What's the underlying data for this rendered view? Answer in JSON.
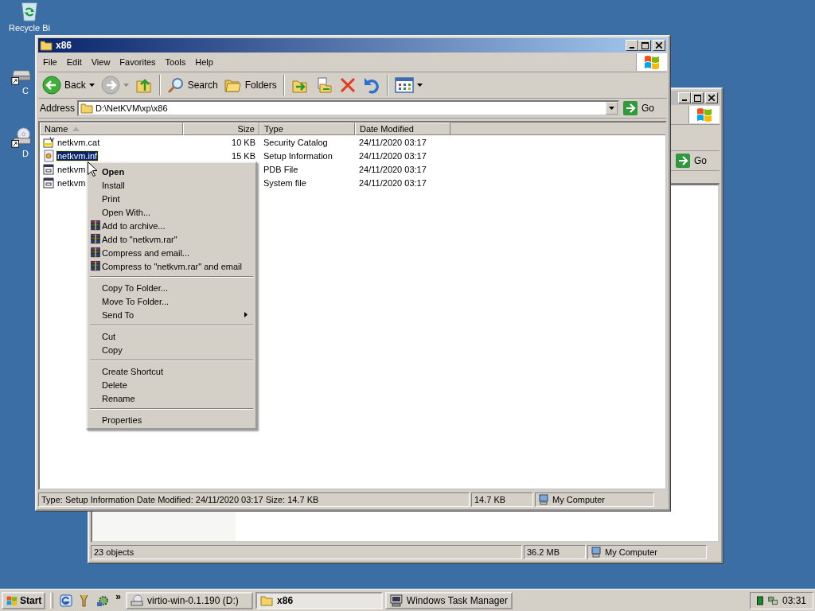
{
  "desktop_icons": [
    {
      "kind": "recycle",
      "label": "Recycle Bi"
    },
    {
      "kind": "drive",
      "label": "C"
    },
    {
      "kind": "cd",
      "label": "D"
    }
  ],
  "back_window": {
    "go": "Go",
    "status_bar": [
      "23 objects",
      "36.2 MB",
      "My Computer"
    ]
  },
  "window": {
    "title": "x86",
    "menu": [
      "File",
      "Edit",
      "View",
      "Favorites",
      "Tools",
      "Help"
    ],
    "toolbar": [
      {
        "kind": "back",
        "label": "Back"
      },
      {
        "kind": "forward"
      },
      {
        "kind": "up"
      },
      {
        "kind": "sep"
      },
      {
        "kind": "search",
        "label": "Search"
      },
      {
        "kind": "folders",
        "label": "Folders"
      },
      {
        "kind": "sep"
      },
      {
        "kind": "moveto"
      },
      {
        "kind": "copyto"
      },
      {
        "kind": "delete"
      },
      {
        "kind": "undo"
      },
      {
        "kind": "sep"
      },
      {
        "kind": "views"
      }
    ],
    "address": {
      "label": "Address",
      "value": "D:\\NetKVM\\xp\\x86",
      "go": "Go"
    },
    "columns": [
      {
        "label": "Name",
        "sorted": true
      },
      {
        "label": "Size",
        "sorted": false
      },
      {
        "label": "Type",
        "sorted": false
      },
      {
        "label": "Date Modified",
        "sorted": false
      }
    ],
    "rows": [
      {
        "kind": "catalog",
        "name": "netkvm.cat",
        "size": "10 KB",
        "type": "Security Catalog",
        "date": "24/11/2020 03:17",
        "selected": false
      },
      {
        "kind": "setup",
        "name": "netkvm.inf",
        "size": "15 KB",
        "type": "Setup Information",
        "date": "24/11/2020 03:17",
        "selected": true
      },
      {
        "kind": "file",
        "name": "netkvm",
        "size": "",
        "type": "PDB File",
        "date": "24/11/2020 03:17",
        "selected": false
      },
      {
        "kind": "file",
        "name": "netkvm",
        "size": "",
        "type": "System file",
        "date": "24/11/2020 03:17",
        "selected": false
      }
    ],
    "status_bar": [
      "Type: Setup Information Date Modified: 24/11/2020 03:17 Size: 14.7 KB",
      "14.7 KB",
      "My Computer"
    ]
  },
  "context_menu": [
    {
      "kind": "default",
      "label": "Open"
    },
    {
      "kind": "item",
      "label": "Install"
    },
    {
      "kind": "item",
      "label": "Print"
    },
    {
      "kind": "item",
      "label": "Open With..."
    },
    {
      "kind": "rar",
      "label": "Add to archive..."
    },
    {
      "kind": "rar",
      "label": "Add to \"netkvm.rar\""
    },
    {
      "kind": "rar",
      "label": "Compress and email..."
    },
    {
      "kind": "rar",
      "label": "Compress to \"netkvm.rar\" and email"
    },
    {
      "kind": "separator"
    },
    {
      "kind": "item",
      "label": "Copy To Folder..."
    },
    {
      "kind": "item",
      "label": "Move To Folder..."
    },
    {
      "kind": "submenu",
      "label": "Send To"
    },
    {
      "kind": "separator"
    },
    {
      "kind": "item",
      "label": "Cut"
    },
    {
      "kind": "item",
      "label": "Copy"
    },
    {
      "kind": "separator"
    },
    {
      "kind": "item",
      "label": "Create Shortcut"
    },
    {
      "kind": "item",
      "label": "Delete"
    },
    {
      "kind": "item",
      "label": "Rename"
    },
    {
      "kind": "separator"
    },
    {
      "kind": "item",
      "label": "Properties"
    }
  ],
  "taskbar": {
    "start": "Start",
    "chevron": "»",
    "tasks": [
      {
        "kind": "drive",
        "label": "virtio-win-0.1.190 (D:)",
        "selected": false
      },
      {
        "kind": "folder",
        "label": "x86",
        "selected": true
      },
      {
        "kind": "monitor",
        "label": "Windows Task Manager",
        "selected": false
      }
    ],
    "clock": "03:31"
  }
}
